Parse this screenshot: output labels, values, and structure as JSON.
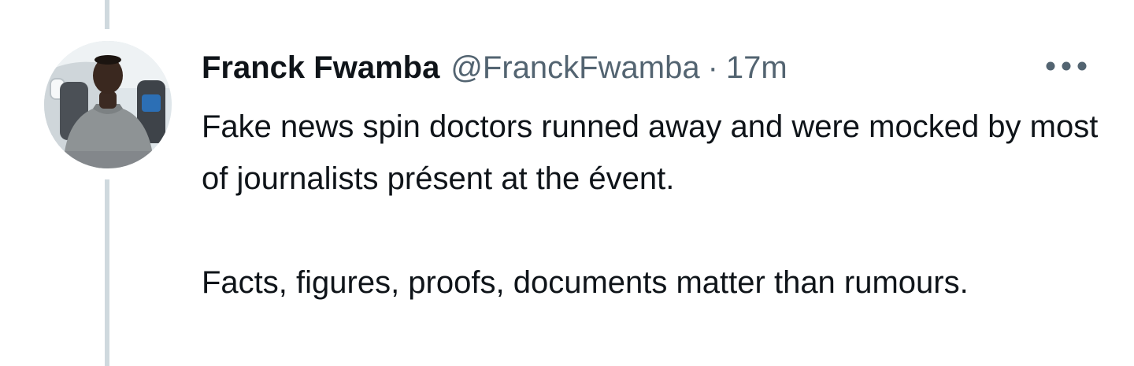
{
  "tweet": {
    "display_name": "Franck Fwamba",
    "handle": "@FranckFwamba",
    "separator": "·",
    "timestamp": "17m",
    "paragraphs": [
      "Fake news spin doctors runned away and were mocked by most of journalists présent at the évent.",
      "Facts, figures, proofs, documents matter than rumours."
    ]
  },
  "icons": {
    "more": "more-horizontal-icon",
    "avatar": "user-avatar"
  },
  "colors": {
    "text_primary": "#0f1419",
    "text_secondary": "#536471",
    "thread_line": "#cfd9de",
    "background": "#ffffff"
  }
}
